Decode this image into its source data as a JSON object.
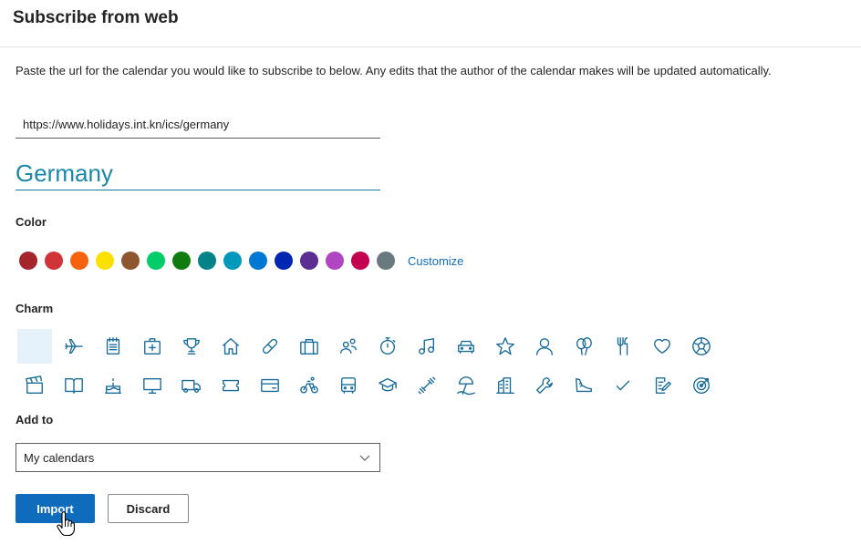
{
  "dialog": {
    "title": "Subscribe from web",
    "description": "Paste the url for the calendar you would like to subscribe to below. Any edits that the author of the calendar makes will be updated automatically."
  },
  "url_input": {
    "value": "https://www.holidays.int.kn/ics/germany"
  },
  "name_input": {
    "value": "Germany"
  },
  "color": {
    "label": "Color",
    "swatches": [
      "#a4262c",
      "#d13438",
      "#f7630c",
      "#fce100",
      "#8e562e",
      "#00cc6a",
      "#107c10",
      "#038387",
      "#0099bc",
      "#0078d4",
      "#0027b4",
      "#5c2e91",
      "#b146c2",
      "#c30052",
      "#69797e"
    ],
    "customize_label": "Customize"
  },
  "charm": {
    "label": "Charm",
    "row1": [
      "none",
      "airplane-icon",
      "notepad-icon",
      "first-aid-icon",
      "trophy-icon",
      "home-icon",
      "pill-icon",
      "briefcase-icon",
      "people-icon",
      "stopwatch-icon",
      "music-note-icon",
      "car-icon",
      "star-icon",
      "person-icon",
      "balloons-icon",
      "food-icon",
      "heart-icon",
      "soccer-ball-icon"
    ],
    "row2": [
      "clapperboard-icon",
      "book-icon",
      "birthday-cake-icon",
      "monitor-icon",
      "truck-icon",
      "ticket-icon",
      "credit-card-icon",
      "bicycle-icon",
      "bus-icon",
      "graduation-cap-icon",
      "dumbbell-icon",
      "beach-icon",
      "building-icon",
      "wrench-icon",
      "sneaker-icon",
      "checkmark-icon",
      "edit-note-icon",
      "target-icon"
    ]
  },
  "add_to": {
    "label": "Add to",
    "selected": "My calendars"
  },
  "buttons": {
    "import_label": "Import",
    "discard_label": "Discard"
  },
  "accent_color": "#0f6cbd"
}
